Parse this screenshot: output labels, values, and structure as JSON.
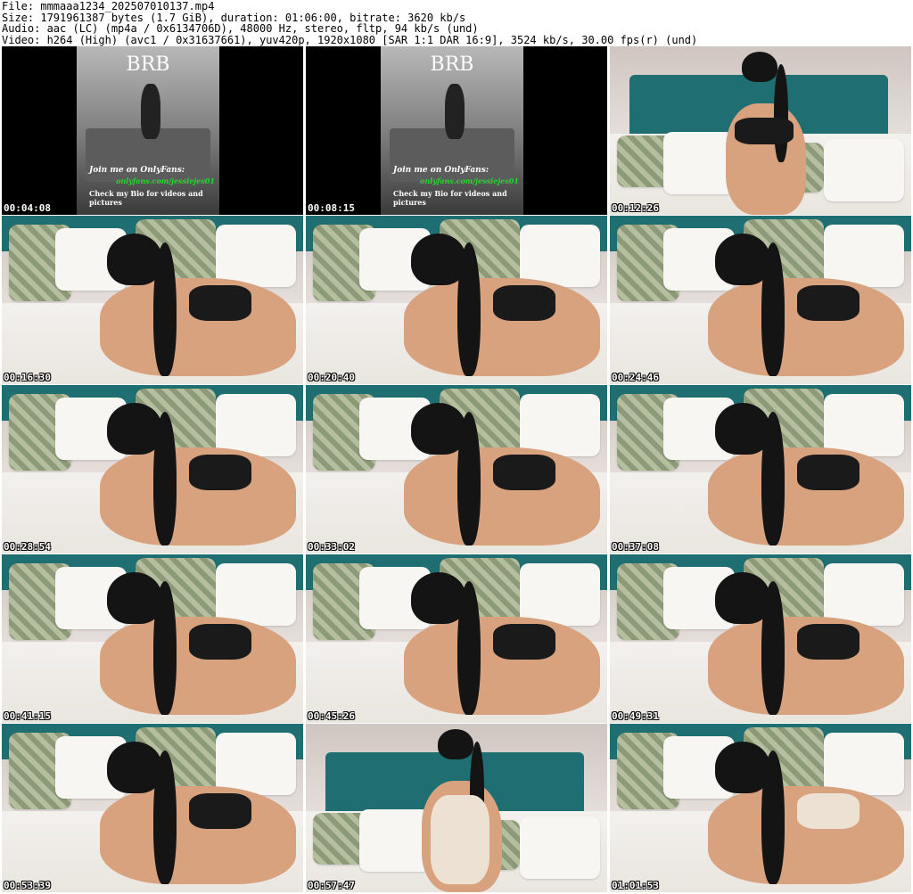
{
  "header": {
    "line1": "File: mmmaaa1234_202507010137.mp4",
    "line2": "Size: 1791961387 bytes (1.7 GiB), duration: 01:06:00, bitrate: 3620 kb/s",
    "line3": "Audio: aac (LC) (mp4a / 0x6134706D), 48000 Hz, stereo, fltp, 94 kb/s (und)",
    "line4": "Video: h264 (High) (avc1 / 0x31637661), yuv420p, 1920x1080 [SAR 1:1 DAR 16:9], 3524 kb/s, 30.00 fps(r) (und)"
  },
  "brb": {
    "title": "BRB",
    "line1": "Join me on OnlyFans:",
    "line2": "onlyfans.com/jessiejes01",
    "line3": "Check my Bio for videos and pictures"
  },
  "thumbnails": [
    {
      "time": "00:04:08",
      "kind": "brb"
    },
    {
      "time": "00:08:15",
      "kind": "brb"
    },
    {
      "time": "00:12:26",
      "kind": "sitting"
    },
    {
      "time": "00:16:30",
      "kind": "lying"
    },
    {
      "time": "00:20:40",
      "kind": "lying"
    },
    {
      "time": "00:24:46",
      "kind": "lying"
    },
    {
      "time": "00:28:54",
      "kind": "lying"
    },
    {
      "time": "00:33:02",
      "kind": "lying"
    },
    {
      "time": "00:37:08",
      "kind": "lying"
    },
    {
      "time": "00:41:15",
      "kind": "lying"
    },
    {
      "time": "00:45:26",
      "kind": "lying"
    },
    {
      "time": "00:49:31",
      "kind": "lying"
    },
    {
      "time": "00:53:39",
      "kind": "lying"
    },
    {
      "time": "00:57:47",
      "kind": "sitting-light"
    },
    {
      "time": "01:01:53",
      "kind": "lying-light"
    }
  ]
}
